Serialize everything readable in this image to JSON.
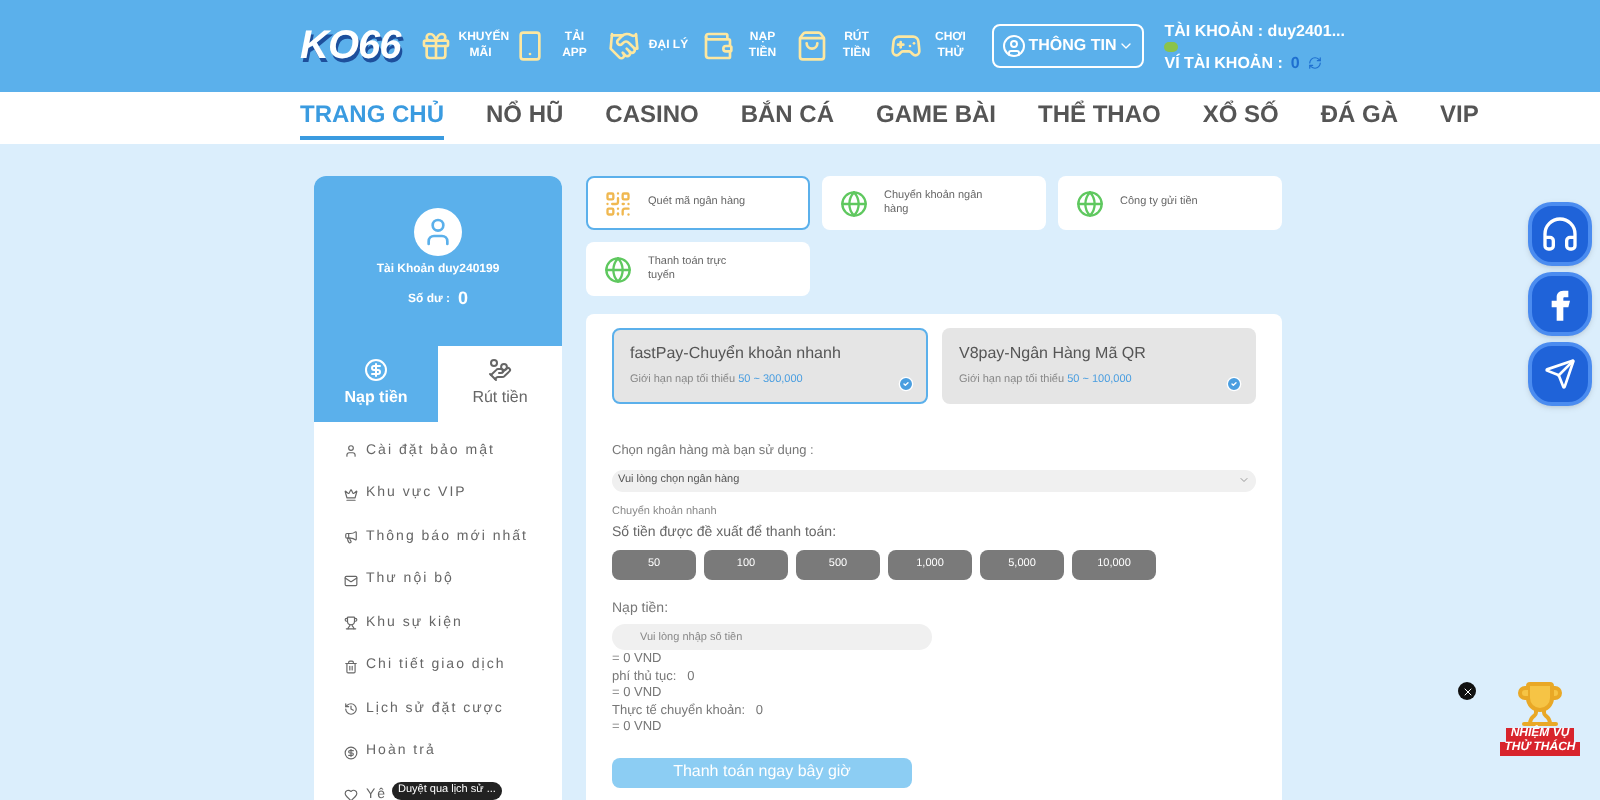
{
  "header": {
    "logo": "KO66",
    "shortcuts": [
      {
        "label": "KHUYẾN MÃI",
        "kind": "gift"
      },
      {
        "label": "TẢI APP",
        "kind": "phone"
      },
      {
        "label": "ĐẠI LÝ",
        "kind": "handshake"
      },
      {
        "label": "NẠP TIỀN",
        "kind": "wallet"
      },
      {
        "label": "RÚT TIỀN",
        "kind": "bag"
      },
      {
        "label": "CHƠI THỬ",
        "kind": "gamepad"
      }
    ],
    "info_button": "THÔNG TIN",
    "account_label": "TÀI KHOẢN : duy2401...",
    "wallet_label": "VÍ TÀI KHOẢN :",
    "wallet_value": "0"
  },
  "nav": [
    {
      "label": "TRANG CHỦ",
      "selected": true
    },
    {
      "label": "NỔ HŨ",
      "selected": false
    },
    {
      "label": "CASINO",
      "selected": false
    },
    {
      "label": "BẮN CÁ",
      "selected": false
    },
    {
      "label": "GAME BÀI",
      "selected": false
    },
    {
      "label": "THỂ THAO",
      "selected": false
    },
    {
      "label": "XỔ SỐ",
      "selected": false
    },
    {
      "label": "ĐÁ GÀ",
      "selected": false
    },
    {
      "label": "VIP",
      "selected": false
    }
  ],
  "profile": {
    "account": "Tài Khoản duy240199",
    "balance_label": "Số dư :",
    "balance": "0"
  },
  "tabs": [
    {
      "label": "Nạp tiền",
      "selected": true
    },
    {
      "label": "Rút tiền",
      "selected": false
    }
  ],
  "menu": [
    {
      "label": "Cài đặt bảo mật",
      "kind": "user"
    },
    {
      "label": "Khu vực VIP",
      "kind": "crown"
    },
    {
      "label": "Thông báo mới nhất",
      "kind": "megaphone"
    },
    {
      "label": "Thư nội bộ",
      "kind": "mail"
    },
    {
      "label": "Khu sự kiện",
      "kind": "trophy"
    },
    {
      "label": "Chi tiết giao dịch",
      "kind": "trash"
    },
    {
      "label": "Lịch sử đặt cược",
      "kind": "history"
    },
    {
      "label": "Hoàn trả",
      "kind": "coin"
    },
    {
      "label": "Yê",
      "kind": "heart"
    }
  ],
  "tooltip": "Duyệt qua lịch sử ...",
  "methods": [
    {
      "label": "Quét mã ngân hàng",
      "kind": "qr",
      "selected": true
    },
    {
      "label": "Chuyển khoản ngân hàng",
      "kind": "globe",
      "selected": false
    },
    {
      "label": "Công ty gửi tiền",
      "kind": "globe",
      "selected": false
    },
    {
      "label": "Thanh toán trực tuyến",
      "kind": "globe",
      "selected": false
    }
  ],
  "channels": [
    {
      "name": "fastPay-Chuyển khoản nhanh",
      "limit_label": "Giới hạn nạp tối thiểu",
      "limit": "50 ~ 300,000",
      "selected": true
    },
    {
      "name": "V8pay-Ngân Hàng Mã QR",
      "limit_label": "Giới hạn nạp tối thiểu",
      "limit": "50 ~ 100,000",
      "selected": false
    }
  ],
  "bank_label": "Chọn ngân hàng mà bạn sử dụng :",
  "bank_select": "Vui lòng chọn ngân hàng",
  "quick_label": "Chuyển khoản nhanh",
  "amount_label": "Số tiền được đề xuất để thanh toán:",
  "amounts": [
    "50",
    "100",
    "500",
    "1,000",
    "5,000",
    "10,000"
  ],
  "deposit_label": "Nạp tiền:",
  "deposit_placeholder": "Vui lòng nhập số tiền",
  "summary": [
    "= 0 VND",
    "phí thủ tục:   0",
    "= 0 VND",
    "Thực tế chuyển khoản:   0",
    "= 0 VND"
  ],
  "submit": "Thanh toán ngay bây giờ",
  "floating": [
    {
      "kind": "headset"
    },
    {
      "kind": "facebook"
    },
    {
      "kind": "telegram"
    }
  ],
  "mission": {
    "line1": "NHIỆM VỤ",
    "line2": "THỬ THÁCH"
  }
}
